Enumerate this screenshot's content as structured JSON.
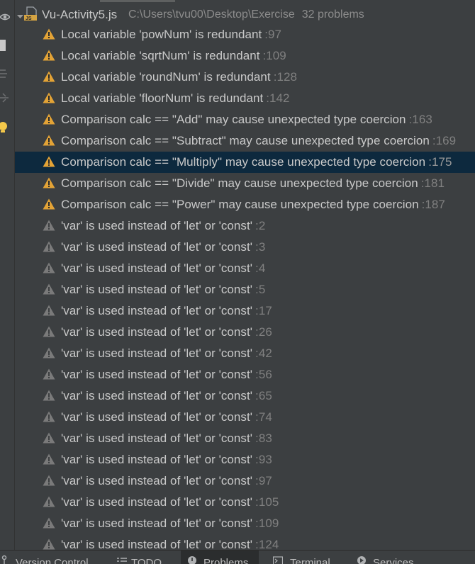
{
  "file": {
    "name": "Vu-Activity5.js",
    "path": "C:\\Users\\tvu00\\Desktop\\Exercise",
    "problem_count": "32 problems"
  },
  "colors": {
    "warning": "#e3a336",
    "weak_warning": "#7a7a7a",
    "selection": "#0d293e"
  },
  "problems": [
    {
      "message": "Local variable 'powNum' is redundant",
      "line": ":97",
      "severity": "warning"
    },
    {
      "message": "Local variable 'sqrtNum' is redundant",
      "line": ":109",
      "severity": "warning"
    },
    {
      "message": "Local variable 'roundNum' is redundant",
      "line": ":128",
      "severity": "warning"
    },
    {
      "message": "Local variable 'floorNum' is redundant",
      "line": ":142",
      "severity": "warning"
    },
    {
      "message": "Comparison calc == \"Add\" may cause unexpected type coercion",
      "line": ":163",
      "severity": "warning"
    },
    {
      "message": "Comparison calc == \"Subtract\" may cause unexpected type coercion",
      "line": ":169",
      "severity": "warning"
    },
    {
      "message": "Comparison calc == \"Multiply\" may cause unexpected type coercion",
      "line": ":175",
      "severity": "warning",
      "selected": true
    },
    {
      "message": "Comparison calc == \"Divide\" may cause unexpected type coercion",
      "line": ":181",
      "severity": "warning"
    },
    {
      "message": "Comparison calc == \"Power\" may cause unexpected type coercion",
      "line": ":187",
      "severity": "warning"
    },
    {
      "message": "'var' is used instead of 'let' or 'const'",
      "line": ":2",
      "severity": "weak"
    },
    {
      "message": "'var' is used instead of 'let' or 'const'",
      "line": ":3",
      "severity": "weak"
    },
    {
      "message": "'var' is used instead of 'let' or 'const'",
      "line": ":4",
      "severity": "weak"
    },
    {
      "message": "'var' is used instead of 'let' or 'const'",
      "line": ":5",
      "severity": "weak"
    },
    {
      "message": "'var' is used instead of 'let' or 'const'",
      "line": ":17",
      "severity": "weak"
    },
    {
      "message": "'var' is used instead of 'let' or 'const'",
      "line": ":26",
      "severity": "weak"
    },
    {
      "message": "'var' is used instead of 'let' or 'const'",
      "line": ":42",
      "severity": "weak"
    },
    {
      "message": "'var' is used instead of 'let' or 'const'",
      "line": ":56",
      "severity": "weak"
    },
    {
      "message": "'var' is used instead of 'let' or 'const'",
      "line": ":65",
      "severity": "weak"
    },
    {
      "message": "'var' is used instead of 'let' or 'const'",
      "line": ":74",
      "severity": "weak"
    },
    {
      "message": "'var' is used instead of 'let' or 'const'",
      "line": ":83",
      "severity": "weak"
    },
    {
      "message": "'var' is used instead of 'let' or 'const'",
      "line": ":93",
      "severity": "weak"
    },
    {
      "message": "'var' is used instead of 'let' or 'const'",
      "line": ":97",
      "severity": "weak"
    },
    {
      "message": "'var' is used instead of 'let' or 'const'",
      "line": ":105",
      "severity": "weak"
    },
    {
      "message": "'var' is used instead of 'let' or 'const'",
      "line": ":109",
      "severity": "weak"
    },
    {
      "message": "'var' is used instead of 'let' or 'const'",
      "line": ":124",
      "severity": "weak"
    }
  ],
  "bottom_tabs": [
    {
      "label": "Version Control",
      "icon": "version-control-icon"
    },
    {
      "label": "TODO",
      "icon": "todo-list-icon"
    },
    {
      "label": "Problems",
      "icon": "problems-icon",
      "active": true
    },
    {
      "label": "Terminal",
      "icon": "terminal-icon"
    },
    {
      "label": "Services",
      "icon": "services-icon"
    }
  ],
  "left_toolbar": [
    {
      "icon": "eye-icon"
    },
    {
      "icon": "square-icon"
    },
    {
      "icon": "expand-all-icon"
    },
    {
      "icon": "collapse-all-icon"
    },
    {
      "icon": "lightbulb-icon"
    }
  ]
}
